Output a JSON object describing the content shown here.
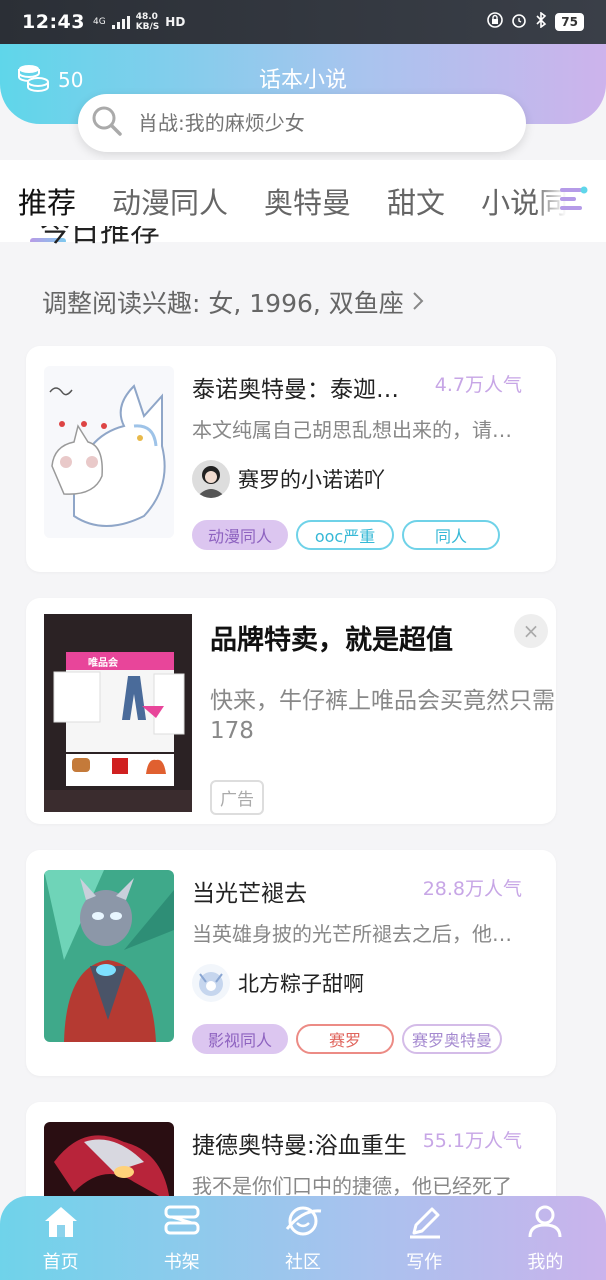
{
  "status_bar": {
    "time": "12:43",
    "network": "4G",
    "speed_value": "48.0",
    "speed_unit": "KB/S",
    "hd": "HD",
    "battery": "75"
  },
  "header": {
    "coin_count": "50",
    "title": "话本小说",
    "search_placeholder": "肖战:我的麻烦少女"
  },
  "tabs": [
    "推荐",
    "动漫同人",
    "奥特曼",
    "甜文",
    "小说同人"
  ],
  "section": {
    "title": "今日推荐",
    "interest": "调整阅读兴趣: 女, 1996, 双鱼座"
  },
  "books": [
    {
      "title": "泰诺奥特曼：泰迦与诺",
      "popularity": "4.7万人气",
      "description": "本文纯属自己胡思乱想出来的，请勿模仿",
      "author": "赛罗的小诺诺吖",
      "tags": [
        {
          "label": "动漫同人",
          "style": "fill"
        },
        {
          "label": "ooc严重",
          "style": "cyan"
        },
        {
          "label": "同人",
          "style": "cyan"
        }
      ]
    },
    {
      "title": "当光芒褪去",
      "popularity": "28.8万人气",
      "description": "当英雄身披的光芒所褪去之后，他们还剩下",
      "author": "北方粽子甜啊",
      "tags": [
        {
          "label": "影视同人",
          "style": "fill"
        },
        {
          "label": "赛罗",
          "style": "red"
        },
        {
          "label": "赛罗奥特曼",
          "style": "purple"
        }
      ]
    },
    {
      "title": "捷德奥特曼:浴血重生",
      "popularity": "55.1万人气",
      "description": "我不是你们口中的捷德，他已经死了"
    }
  ],
  "ad": {
    "title": "品牌特卖，就是超值",
    "description": "快来，牛仔裤上唯品会买竟然只需\n178",
    "badge": "广告",
    "close": "×",
    "image_brand": "唯品会"
  },
  "bottom_nav": [
    {
      "label": "首页",
      "icon": "home-icon",
      "active": true
    },
    {
      "label": "书架",
      "icon": "bookshelf-icon",
      "active": false
    },
    {
      "label": "社区",
      "icon": "planet-icon",
      "active": false
    },
    {
      "label": "写作",
      "icon": "pen-icon",
      "active": false
    },
    {
      "label": "我的",
      "icon": "person-icon",
      "active": false
    }
  ],
  "colors": {
    "accent_cyan": "#5fd6ea",
    "accent_purple": "#cdb3ec",
    "popularity": "#c7a6e6"
  }
}
